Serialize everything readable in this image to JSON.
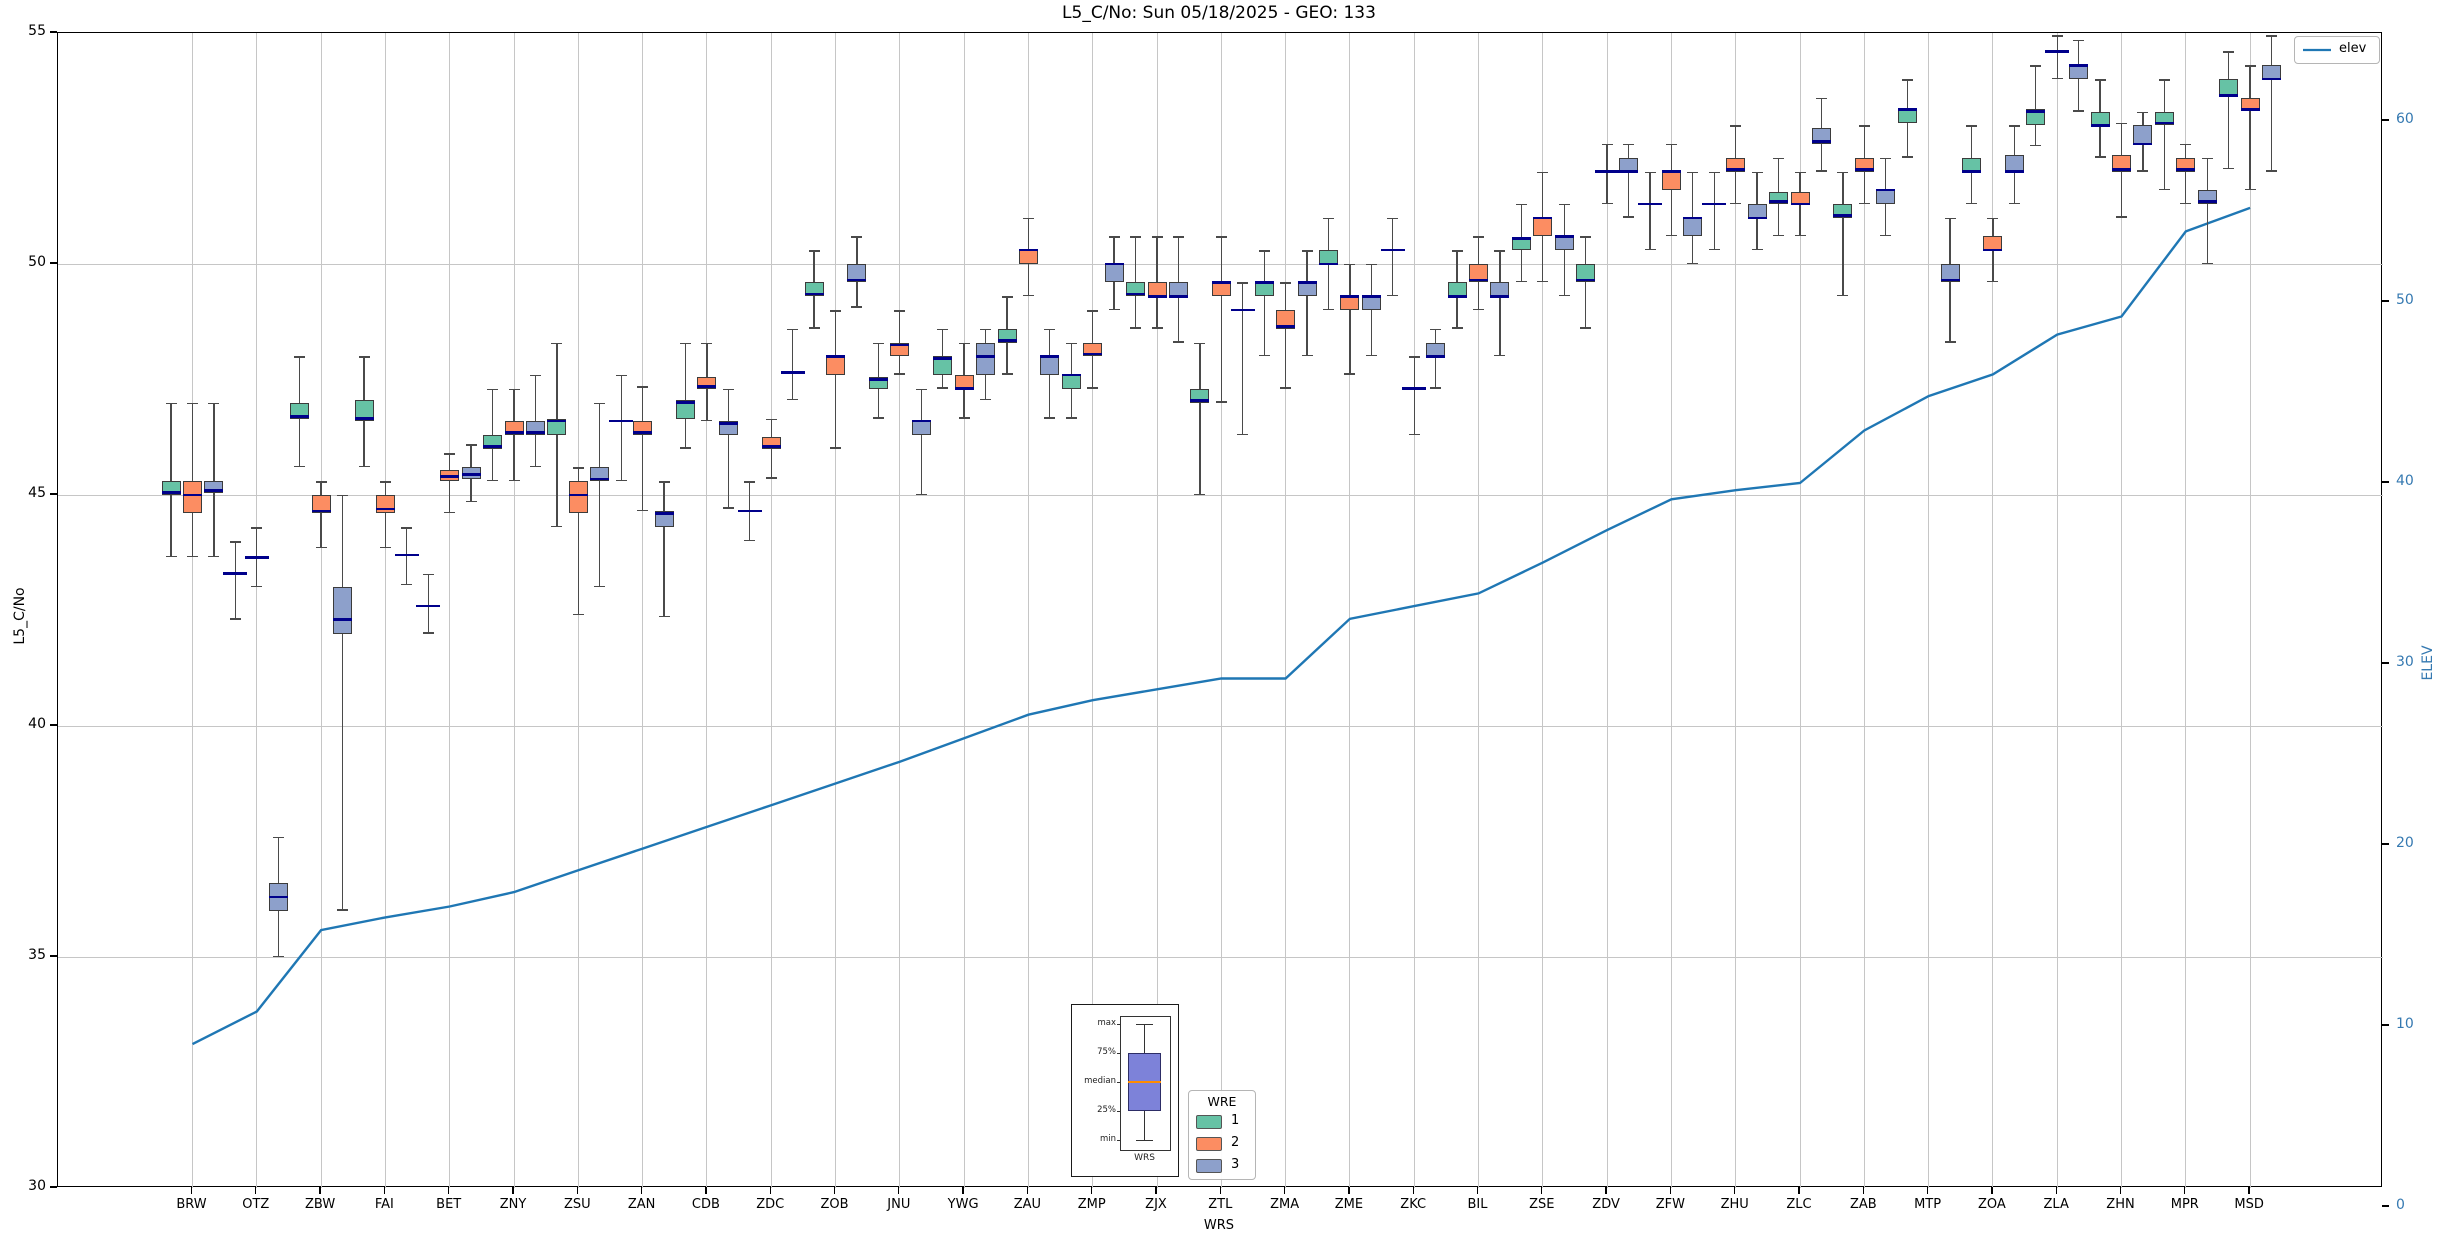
{
  "title": "L5_C/No: Sun 05/18/2025 - GEO: 133",
  "legend": {
    "title": "WRE",
    "entries": [
      "1",
      "2",
      "3"
    ]
  },
  "elev_legend": {
    "label": "elev"
  },
  "inset": {
    "labels": [
      "max",
      "75%",
      "median",
      "25%",
      "min"
    ],
    "xlabel": "WRS",
    "box_color": "#7d82d9",
    "median_color": "#ff8c00"
  },
  "chart_data": {
    "type": "boxplot+line",
    "title": "L5_C/No: Sun 05/18/2025 - GEO: 133",
    "xlabel": "WRS",
    "ylabel": "L5_C/No",
    "y2label": "ELEV",
    "ylim": [
      30,
      55
    ],
    "yticks": [
      55,
      50,
      45,
      40,
      35,
      30
    ],
    "y2ticks": [
      60,
      50,
      40,
      30,
      20,
      10,
      0
    ],
    "grid": true,
    "categories": [
      "BRW",
      "OTZ",
      "ZBW",
      "FAI",
      "BET",
      "ZNY",
      "ZSU",
      "ZAN",
      "CDB",
      "ZDC",
      "ZOB",
      "JNU",
      "YWG",
      "ZAU",
      "ZMP",
      "ZJX",
      "ZTL",
      "ZMA",
      "ZME",
      "ZKC",
      "BIL",
      "ZSE",
      "ZDV",
      "ZFW",
      "ZHU",
      "ZLC",
      "ZAB",
      "MTP",
      "ZOA",
      "ZLA",
      "ZHN",
      "MPR",
      "MSD"
    ],
    "box_format": [
      "lo",
      "q1",
      "med",
      "q3",
      "hi"
    ],
    "series": [
      {
        "name": "1",
        "color": "#66c2a5",
        "boxes": [
          [
            43.65,
            45.0,
            45.05,
            45.3,
            47.0
          ],
          [
            42.3,
            43.3,
            43.3,
            43.3,
            44.0
          ],
          [
            45.6,
            46.65,
            46.7,
            47.0,
            48.0
          ],
          [
            45.6,
            46.6,
            46.65,
            47.05,
            48.0
          ],
          [
            42.0,
            42.6,
            42.6,
            42.6,
            43.3
          ],
          [
            45.3,
            46.0,
            46.05,
            46.3,
            47.3
          ],
          [
            44.3,
            46.3,
            46.6,
            46.65,
            48.3
          ],
          [
            45.3,
            46.6,
            46.6,
            46.6,
            47.6
          ],
          [
            46.0,
            46.65,
            47.0,
            47.05,
            48.3
          ],
          [
            44.0,
            44.65,
            44.65,
            44.65,
            45.3
          ],
          [
            48.6,
            49.3,
            49.35,
            49.6,
            50.3
          ],
          [
            46.65,
            47.3,
            47.5,
            47.55,
            48.3
          ],
          [
            47.3,
            47.6,
            47.95,
            48.0,
            48.6
          ],
          [
            47.6,
            48.3,
            48.35,
            48.6,
            49.3
          ],
          [
            46.65,
            47.3,
            47.6,
            47.6,
            48.3
          ],
          [
            48.6,
            49.3,
            49.35,
            49.6,
            50.6
          ],
          [
            45.0,
            47.0,
            47.05,
            47.3,
            48.3
          ],
          [
            48.0,
            49.3,
            49.6,
            49.6,
            50.3
          ],
          [
            49.0,
            50.0,
            50.0,
            50.3,
            51.0
          ],
          [
            49.3,
            50.3,
            50.3,
            50.3,
            51.0
          ],
          [
            48.6,
            49.3,
            49.3,
            49.6,
            50.3
          ],
          [
            49.6,
            50.3,
            50.55,
            50.55,
            51.3
          ],
          [
            48.6,
            49.6,
            49.65,
            50.0,
            50.6
          ],
          [
            50.3,
            51.3,
            51.3,
            51.3,
            52.0
          ],
          [
            50.3,
            51.3,
            51.3,
            51.3,
            52.0
          ],
          [
            50.6,
            51.3,
            51.35,
            51.55,
            52.3
          ],
          [
            49.3,
            51.0,
            51.05,
            51.3,
            52.0
          ],
          [
            52.3,
            53.05,
            53.35,
            53.35,
            54.0
          ],
          [
            51.3,
            52.0,
            52.0,
            52.3,
            53.0
          ],
          [
            52.55,
            53.0,
            53.3,
            53.35,
            54.3
          ],
          [
            52.3,
            53.0,
            53.0,
            53.3,
            54.0
          ],
          [
            51.6,
            53.0,
            53.05,
            53.3,
            54.0
          ],
          [
            52.05,
            53.65,
            53.65,
            54.0,
            54.6
          ]
        ]
      },
      {
        "name": "2",
        "color": "#fc8d62",
        "boxes": [
          [
            43.65,
            44.6,
            45.0,
            45.3,
            47.0
          ],
          [
            43.0,
            43.65,
            43.65,
            43.65,
            44.3
          ],
          [
            43.85,
            44.6,
            44.65,
            45.0,
            45.3
          ],
          [
            43.85,
            44.6,
            44.7,
            45.0,
            45.3
          ],
          [
            44.6,
            45.3,
            45.4,
            45.55,
            45.9
          ],
          [
            45.3,
            46.3,
            46.35,
            46.6,
            47.3
          ],
          [
            42.4,
            44.6,
            45.0,
            45.3,
            45.6
          ],
          [
            44.65,
            46.3,
            46.35,
            46.6,
            47.35
          ],
          [
            46.6,
            47.3,
            47.35,
            47.55,
            48.3
          ],
          [
            45.35,
            46.0,
            46.05,
            46.25,
            46.65
          ],
          [
            46.0,
            47.6,
            48.0,
            48.0,
            49.0
          ],
          [
            47.6,
            48.0,
            48.25,
            48.3,
            49.0
          ],
          [
            46.65,
            47.3,
            47.3,
            47.6,
            48.3
          ],
          [
            49.3,
            50.0,
            50.3,
            50.3,
            51.0
          ],
          [
            47.3,
            48.0,
            48.05,
            48.3,
            49.0
          ],
          [
            48.6,
            49.3,
            49.3,
            49.6,
            50.6
          ],
          [
            47.0,
            49.3,
            49.6,
            49.6,
            50.6
          ],
          [
            47.3,
            48.6,
            48.65,
            49.0,
            49.6
          ],
          [
            47.6,
            49.0,
            49.3,
            49.3,
            50.0
          ],
          [
            46.3,
            47.3,
            47.3,
            47.3,
            48.0
          ],
          [
            49.0,
            49.6,
            49.65,
            50.0,
            50.6
          ],
          [
            49.6,
            50.6,
            51.0,
            51.0,
            52.0
          ],
          [
            51.3,
            52.0,
            52.0,
            52.0,
            52.6
          ],
          [
            50.6,
            51.6,
            52.0,
            52.0,
            52.6
          ],
          [
            51.3,
            52.0,
            52.05,
            52.3,
            53.0
          ],
          [
            50.6,
            51.3,
            51.3,
            51.55,
            52.0
          ],
          [
            51.3,
            52.0,
            52.05,
            52.3,
            53.0
          ],
          null,
          [
            49.6,
            50.3,
            50.3,
            50.6,
            51.0
          ],
          [
            54.0,
            54.6,
            54.6,
            54.6,
            54.95
          ],
          [
            51.0,
            52.0,
            52.05,
            52.35,
            53.05
          ],
          [
            51.3,
            52.0,
            52.05,
            52.3,
            52.6
          ],
          [
            51.6,
            53.35,
            53.35,
            53.6,
            54.3
          ]
        ]
      },
      {
        "name": "3",
        "color": "#8da0cb",
        "boxes": [
          [
            43.65,
            45.05,
            45.1,
            45.3,
            47.0
          ],
          [
            35.0,
            36.0,
            36.3,
            36.6,
            37.6
          ],
          [
            36.0,
            42.0,
            42.3,
            43.0,
            45.0
          ],
          [
            43.05,
            43.7,
            43.7,
            43.7,
            44.3
          ],
          [
            44.85,
            45.35,
            45.45,
            45.6,
            46.1
          ],
          [
            45.6,
            46.3,
            46.35,
            46.6,
            47.6
          ],
          [
            43.0,
            45.3,
            45.35,
            45.6,
            47.0
          ],
          [
            42.35,
            44.3,
            44.6,
            44.65,
            45.3
          ],
          [
            44.7,
            46.3,
            46.55,
            46.6,
            47.3
          ],
          [
            47.05,
            47.65,
            47.65,
            47.65,
            48.6
          ],
          [
            49.05,
            49.6,
            49.65,
            50.0,
            50.6
          ],
          [
            45.0,
            46.3,
            46.6,
            46.6,
            47.3
          ],
          [
            47.05,
            47.6,
            48.0,
            48.3,
            48.6
          ],
          [
            46.65,
            47.6,
            48.0,
            48.0,
            48.6
          ],
          [
            49.0,
            49.6,
            50.0,
            50.0,
            50.6
          ],
          [
            48.3,
            49.3,
            49.3,
            49.6,
            50.6
          ],
          [
            46.3,
            49.0,
            49.0,
            49.0,
            49.6
          ],
          [
            48.0,
            49.3,
            49.6,
            49.6,
            50.3
          ],
          [
            48.0,
            49.0,
            49.3,
            49.3,
            50.0
          ],
          [
            47.3,
            48.0,
            48.0,
            48.3,
            48.6
          ],
          [
            48.0,
            49.3,
            49.3,
            49.6,
            50.3
          ],
          [
            49.3,
            50.3,
            50.6,
            50.6,
            51.3
          ],
          [
            51.0,
            52.0,
            52.0,
            52.3,
            52.6
          ],
          [
            50.0,
            50.6,
            51.0,
            51.0,
            52.0
          ],
          [
            50.3,
            51.0,
            51.0,
            51.3,
            52.0
          ],
          [
            52.0,
            52.6,
            52.65,
            52.95,
            53.6
          ],
          [
            50.6,
            51.3,
            51.6,
            51.6,
            52.3
          ],
          [
            48.3,
            49.6,
            49.65,
            50.0,
            51.0
          ],
          [
            51.3,
            52.0,
            52.0,
            52.35,
            53.0
          ],
          [
            53.3,
            54.0,
            54.3,
            54.3,
            54.85
          ],
          [
            52.0,
            52.6,
            52.6,
            53.0,
            53.3
          ],
          [
            50.0,
            51.3,
            51.35,
            51.6,
            52.3
          ],
          [
            52.0,
            54.0,
            54.0,
            54.3,
            54.95
          ]
        ]
      }
    ],
    "line": {
      "name": "elev",
      "color": "#1f77b4",
      "values": [
        9.0,
        10.8,
        15.3,
        16.0,
        16.6,
        17.4,
        18.6,
        19.8,
        21.0,
        22.2,
        23.4,
        24.6,
        25.9,
        27.2,
        28.0,
        28.6,
        29.2,
        29.2,
        32.5,
        33.2,
        33.9,
        35.6,
        37.4,
        39.1,
        39.6,
        40.0,
        42.9,
        44.8,
        46.0,
        48.2,
        49.2,
        53.9,
        55.2
      ]
    },
    "median_color": "#00008b",
    "legend_position": "bottom-center",
    "elev_legend_position": "top-right"
  }
}
